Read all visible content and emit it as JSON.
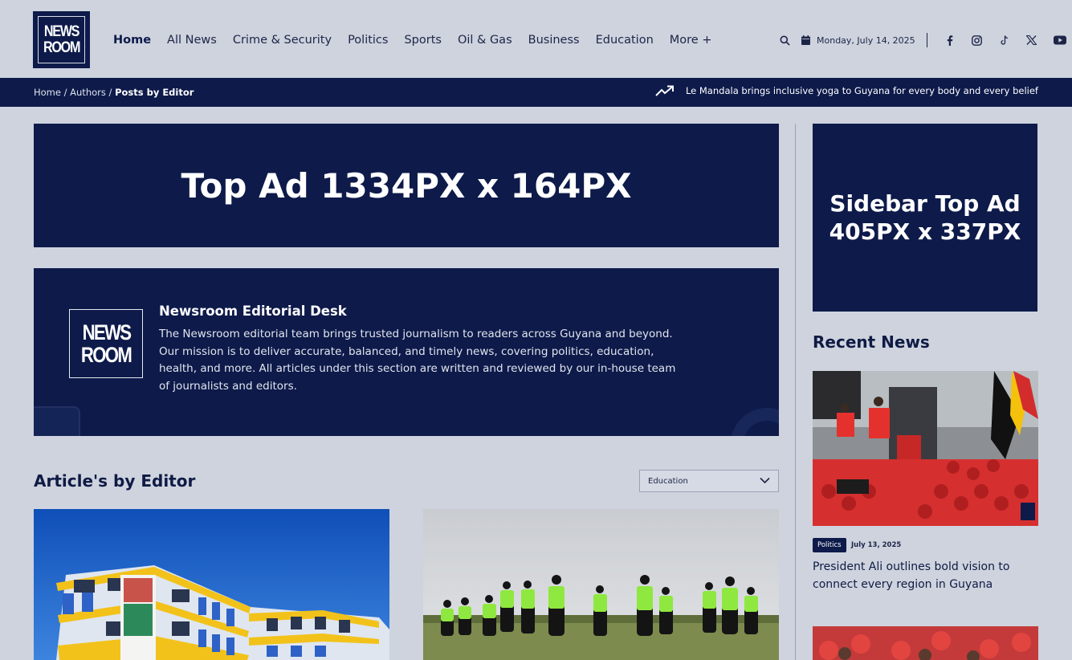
{
  "brand": {
    "logo_line1": "NEWS",
    "logo_line2": "ROOM"
  },
  "nav": {
    "items": [
      "Home",
      "All News",
      "Crime & Security",
      "Politics",
      "Sports",
      "Oil & Gas",
      "Business",
      "Education",
      "More +"
    ],
    "active": "Home"
  },
  "header": {
    "date": "Monday, July 14, 2025"
  },
  "breadcrumb": {
    "home": "Home",
    "sep1": " / ",
    "authors": "Authors",
    "sep2": " / ",
    "current": "Posts by Editor"
  },
  "ticker": {
    "text": "Le Mandala brings inclusive yoga to Guyana for every body and every belief"
  },
  "top_ad": {
    "label": "Top Ad 1334PX x 164PX"
  },
  "author": {
    "name": "Newsroom Editorial Desk",
    "bio": "The Newsroom editorial team brings trusted journalism to readers across Guyana and beyond. Our mission is to deliver accurate, balanced, and timely news, covering politics, education, health, and more. All articles under this section are written and reviewed by our in-house team of journalists and editors."
  },
  "articles": {
    "title": "Article's by Editor",
    "filter_value": "Education"
  },
  "sidebar": {
    "ad_line1": "Sidebar Top Ad",
    "ad_line2": "405PX x 337PX",
    "recent_title": "Recent News",
    "recent": [
      {
        "tag": "Politics",
        "date": "July 13, 2025",
        "title": "President Ali outlines bold vision to connect every region in Guyana"
      }
    ]
  },
  "colors": {
    "navy": "#0d1a4a",
    "page_bg": "#ced3de",
    "text": "#0f1b44"
  },
  "icons": [
    "search-icon",
    "calendar-icon",
    "facebook-icon",
    "instagram-icon",
    "tiktok-icon",
    "x-icon",
    "youtube-icon",
    "trending-icon",
    "chevron-down-icon"
  ]
}
